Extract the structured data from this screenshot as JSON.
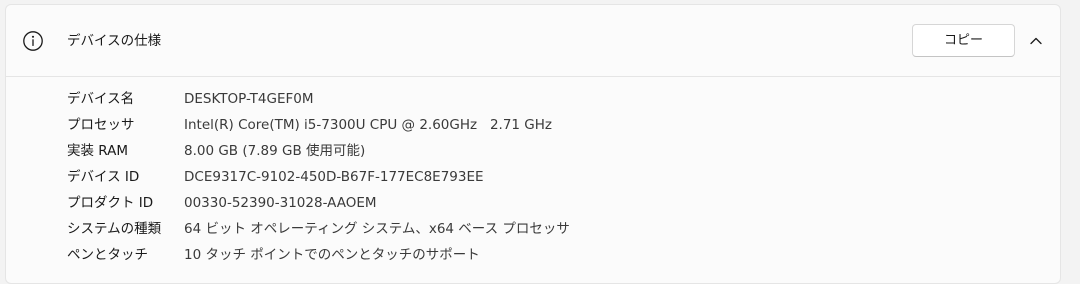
{
  "section": {
    "title": "デバイスの仕様",
    "icon": "info-icon",
    "copy_label": "コピー",
    "collapse_icon": "chevron-up-icon"
  },
  "specs": [
    {
      "label": "デバイス名",
      "value": "DESKTOP-T4GEF0M"
    },
    {
      "label": "プロセッサ",
      "value": "Intel(R) Core(TM) i5-7300U CPU @ 2.60GHz   2.71 GHz"
    },
    {
      "label": "実装 RAM",
      "value": "8.00 GB (7.89 GB 使用可能)"
    },
    {
      "label": "デバイス ID",
      "value": "DCE9317C-9102-450D-B67F-177EC8E793EE"
    },
    {
      "label": "プロダクト ID",
      "value": "00330-52390-31028-AAOEM"
    },
    {
      "label": "システムの種類",
      "value": "64 ビット オペレーティング システム、x64 ベース プロセッサ"
    },
    {
      "label": "ペンとタッチ",
      "value": "10 タッチ ポイントでのペンとタッチのサポート"
    }
  ]
}
